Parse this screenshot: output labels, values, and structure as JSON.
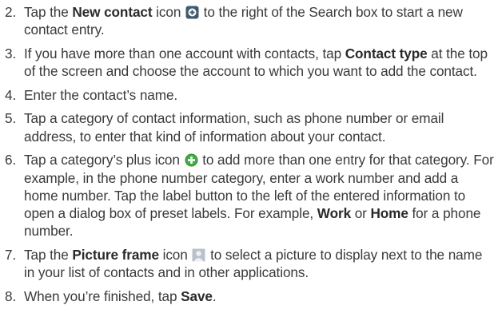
{
  "steps": [
    {
      "number": "2.",
      "parts": [
        {
          "t": "Tap the "
        },
        {
          "t": "New contact",
          "b": true
        },
        {
          "t": " icon "
        },
        {
          "icon": "new-contact-icon"
        },
        {
          "t": " to the right of the Search box to start a new contact entry."
        }
      ]
    },
    {
      "number": "3.",
      "parts": [
        {
          "t": "If you have more than one account with contacts, tap "
        },
        {
          "t": "Contact type",
          "b": true
        },
        {
          "t": " at the top of the screen and choose the account to which you want to add the contact."
        }
      ]
    },
    {
      "number": "4.",
      "parts": [
        {
          "t": "Enter the contact’s name."
        }
      ]
    },
    {
      "number": "5.",
      "parts": [
        {
          "t": "Tap a category of contact information, such as phone number or email address, to enter that kind of information about your contact."
        }
      ]
    },
    {
      "number": "6.",
      "parts": [
        {
          "t": "Tap a category’s plus icon "
        },
        {
          "icon": "plus-icon"
        },
        {
          "t": " to add more than one entry for that category. For example, in the phone number category, enter a work number and add a home number. Tap the label button to the left of the entered information to open a dialog box of preset labels. For example, "
        },
        {
          "t": "Work",
          "b": true
        },
        {
          "t": " or "
        },
        {
          "t": "Home",
          "b": true
        },
        {
          "t": " for a phone number."
        }
      ]
    },
    {
      "number": "7.",
      "parts": [
        {
          "t": "Tap the "
        },
        {
          "t": "Picture frame",
          "b": true
        },
        {
          "t": " icon "
        },
        {
          "icon": "picture-frame-icon"
        },
        {
          "t": " to select a picture to display next to the name in your list of contacts and in other applications."
        }
      ]
    },
    {
      "number": "8.",
      "parts": [
        {
          "t": "When you’re finished, tap "
        },
        {
          "t": "Save",
          "b": true
        },
        {
          "t": "."
        }
      ]
    }
  ]
}
